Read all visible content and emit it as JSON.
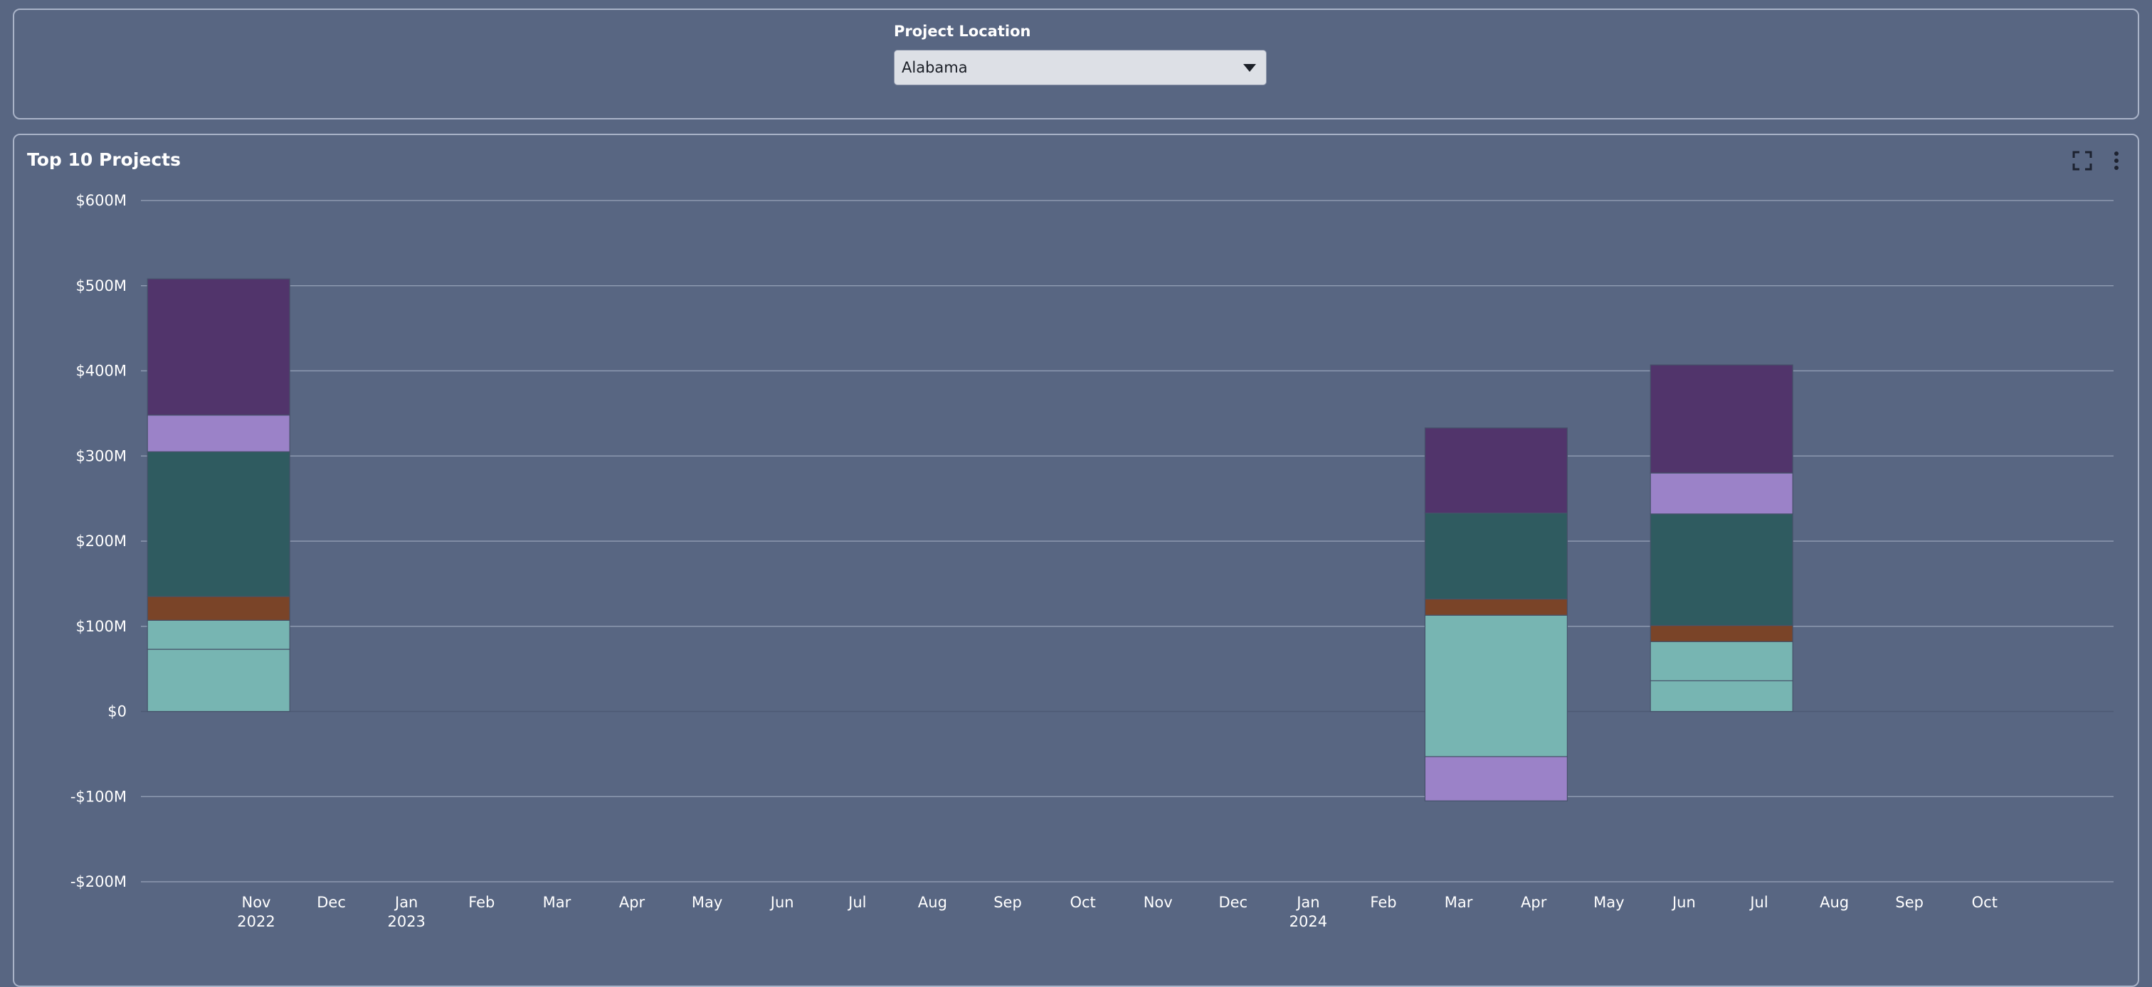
{
  "filter": {
    "label": "Project Location",
    "selected": "Alabama"
  },
  "chart_title": "Top 10 Projects",
  "icons": [
    "fullscreen-icon",
    "more-vert-icon"
  ],
  "colors": {
    "background": "#586682",
    "grid": "#8d99b0",
    "segments": [
      "#77b5b2",
      "#77b5b2",
      "#7a4428",
      "#2f5b60",
      "#9b82c8",
      "#51346b"
    ]
  },
  "chart_data": {
    "type": "bar",
    "stacked": true,
    "title": "Top 10 Projects",
    "xlabel": "",
    "ylabel": "",
    "ylim": [
      -200,
      600
    ],
    "y_unit": "$M",
    "y_ticks": [
      600,
      500,
      400,
      300,
      200,
      100,
      0,
      -100,
      -200
    ],
    "y_tick_labels": [
      "$600M",
      "$500M",
      "$400M",
      "$300M",
      "$200M",
      "$100M",
      "$0",
      "-$100M",
      "-$200M"
    ],
    "x_ticks": [
      {
        "label": "Nov",
        "year": "2022"
      },
      {
        "label": "Dec",
        "year": ""
      },
      {
        "label": "Jan",
        "year": "2023"
      },
      {
        "label": "Feb",
        "year": ""
      },
      {
        "label": "Mar",
        "year": ""
      },
      {
        "label": "Apr",
        "year": ""
      },
      {
        "label": "May",
        "year": ""
      },
      {
        "label": "Jun",
        "year": ""
      },
      {
        "label": "Jul",
        "year": ""
      },
      {
        "label": "Aug",
        "year": ""
      },
      {
        "label": "Sep",
        "year": ""
      },
      {
        "label": "Oct",
        "year": ""
      },
      {
        "label": "Nov",
        "year": ""
      },
      {
        "label": "Dec",
        "year": ""
      },
      {
        "label": "Jan",
        "year": "2024"
      },
      {
        "label": "Feb",
        "year": ""
      },
      {
        "label": "Mar",
        "year": ""
      },
      {
        "label": "Apr",
        "year": ""
      },
      {
        "label": "May",
        "year": ""
      },
      {
        "label": "Jun",
        "year": ""
      },
      {
        "label": "Jul",
        "year": ""
      },
      {
        "label": "Aug",
        "year": ""
      },
      {
        "label": "Sep",
        "year": ""
      },
      {
        "label": "Oct",
        "year": ""
      }
    ],
    "bars": [
      {
        "month": "2022-11",
        "segments": [
          {
            "color": "#77b5b2",
            "from": 0,
            "to": 73
          },
          {
            "color": "#77b5b2",
            "from": 73,
            "to": 107
          },
          {
            "color": "#7a4428",
            "from": 107,
            "to": 135
          },
          {
            "color": "#2f5b60",
            "from": 135,
            "to": 305
          },
          {
            "color": "#9b82c8",
            "from": 305,
            "to": 348
          },
          {
            "color": "#51346b",
            "from": 348,
            "to": 508
          }
        ]
      },
      {
        "month": "2024-04",
        "segments": [
          {
            "color": "#9b82c8",
            "from": -105,
            "to": -53
          },
          {
            "color": "#77b5b2",
            "from": -53,
            "to": 113
          },
          {
            "color": "#7a4428",
            "from": 113,
            "to": 132
          },
          {
            "color": "#2f5b60",
            "from": 132,
            "to": 233
          },
          {
            "color": "#51346b",
            "from": 233,
            "to": 333
          }
        ]
      },
      {
        "month": "2024-07",
        "segments": [
          {
            "color": "#77b5b2",
            "from": 0,
            "to": 36
          },
          {
            "color": "#77b5b2",
            "from": 36,
            "to": 82
          },
          {
            "color": "#7a4428",
            "from": 82,
            "to": 101
          },
          {
            "color": "#2f5b60",
            "from": 101,
            "to": 232
          },
          {
            "color": "#9b82c8",
            "from": 232,
            "to": 280
          },
          {
            "color": "#51346b",
            "from": 280,
            "to": 407
          }
        ]
      }
    ]
  }
}
